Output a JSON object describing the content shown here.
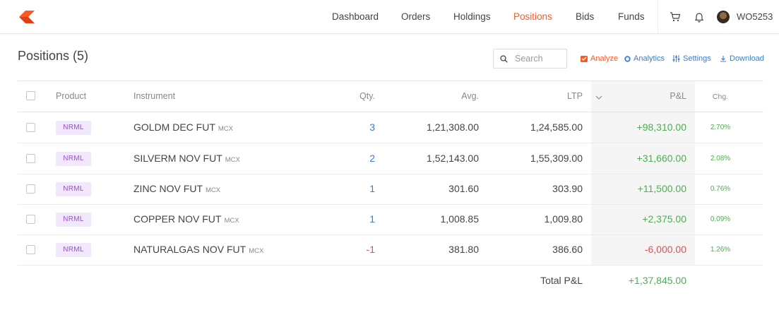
{
  "header": {
    "nav": [
      "Dashboard",
      "Orders",
      "Holdings",
      "Positions",
      "Bids",
      "Funds"
    ],
    "active": "Positions",
    "user_id": "WO5253"
  },
  "page": {
    "title": "Positions (5)",
    "search_placeholder": "Search",
    "tools": {
      "analyze": "Analyze",
      "analytics": "Analytics",
      "settings": "Settings",
      "download": "Download"
    }
  },
  "table": {
    "columns": {
      "product": "Product",
      "instrument": "Instrument",
      "qty": "Qty.",
      "avg": "Avg.",
      "ltp": "LTP",
      "pnl": "P&L",
      "chg": "Chg."
    },
    "rows": [
      {
        "product": "NRML",
        "instrument": "GOLDM DEC FUT",
        "exchange": "MCX",
        "qty": "3",
        "avg": "1,21,308.00",
        "ltp": "1,24,585.00",
        "pnl": "+98,310.00",
        "chg": "2.70%"
      },
      {
        "product": "NRML",
        "instrument": "SILVERM NOV FUT",
        "exchange": "MCX",
        "qty": "2",
        "avg": "1,52,143.00",
        "ltp": "1,55,309.00",
        "pnl": "+31,660.00",
        "chg": "2.08%"
      },
      {
        "product": "NRML",
        "instrument": "ZINC NOV FUT",
        "exchange": "MCX",
        "qty": "1",
        "avg": "301.60",
        "ltp": "303.90",
        "pnl": "+11,500.00",
        "chg": "0.76%"
      },
      {
        "product": "NRML",
        "instrument": "COPPER NOV FUT",
        "exchange": "MCX",
        "qty": "1",
        "avg": "1,008.85",
        "ltp": "1,009.80",
        "pnl": "+2,375.00",
        "chg": "0.09%"
      },
      {
        "product": "NRML",
        "instrument": "NATURALGAS NOV FUT",
        "exchange": "MCX",
        "qty": "-1",
        "avg": "381.80",
        "ltp": "386.60",
        "pnl": "-6,000.00",
        "chg": "1.26%"
      }
    ],
    "total_label": "Total P&L",
    "total_value": "+1,37,845.00"
  },
  "colors": {
    "accent": "#ff5722",
    "link": "#387ed1",
    "positive": "#4caf50",
    "negative": "#df514c",
    "product_badge": "#9b4dd6"
  }
}
